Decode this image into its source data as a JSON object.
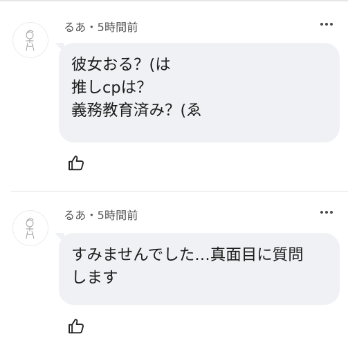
{
  "comments": [
    {
      "author_time": "るあ・5時間前",
      "lines": [
        "彼女おる？(は",
        "推しcpは？",
        "義務教育済み？(ゑ"
      ]
    },
    {
      "author_time": "るあ・5時間前",
      "lines": [
        "すみませんでした…真面目に質問",
        "します"
      ]
    }
  ],
  "icons": {
    "more": "more-horizontal-icon",
    "like": "thumbs-up-icon",
    "avatar": "avatar-sketch-icon"
  }
}
